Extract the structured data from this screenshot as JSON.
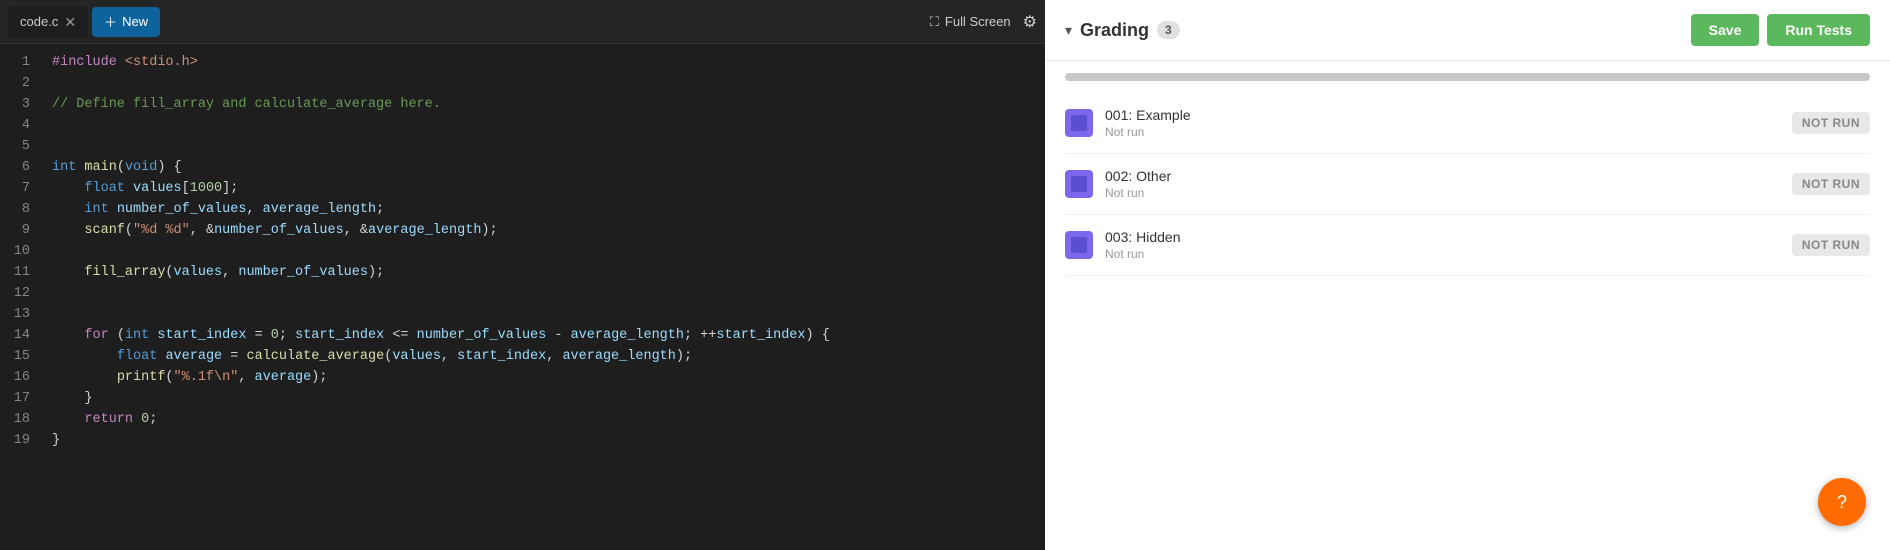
{
  "editor": {
    "tab_filename": "code.c",
    "new_tab_label": "New",
    "fullscreen_label": "Full Screen",
    "lines": [
      {
        "num": 1,
        "tokens": [
          {
            "t": "kw-include",
            "v": "#include"
          },
          {
            "t": "kw-punct",
            "v": " "
          },
          {
            "t": "kw-header",
            "v": "<stdio.h>"
          }
        ]
      },
      {
        "num": 2,
        "tokens": []
      },
      {
        "num": 3,
        "tokens": [
          {
            "t": "kw-comment",
            "v": "// Define fill_array and calculate_average here."
          }
        ]
      },
      {
        "num": 4,
        "tokens": []
      },
      {
        "num": 5,
        "tokens": []
      },
      {
        "num": 6,
        "tokens": [
          {
            "t": "kw-int",
            "v": "int"
          },
          {
            "t": "kw-punct",
            "v": " "
          },
          {
            "t": "kw-fn",
            "v": "main"
          },
          {
            "t": "kw-punct",
            "v": "("
          },
          {
            "t": "kw-void",
            "v": "void"
          },
          {
            "t": "kw-punct",
            "v": ") {"
          }
        ]
      },
      {
        "num": 7,
        "tokens": [
          {
            "t": "kw-punct",
            "v": "    "
          },
          {
            "t": "kw-float",
            "v": "float"
          },
          {
            "t": "kw-punct",
            "v": " "
          },
          {
            "t": "kw-var",
            "v": "values"
          },
          {
            "t": "kw-punct",
            "v": "["
          },
          {
            "t": "kw-num",
            "v": "1000"
          },
          {
            "t": "kw-punct",
            "v": "];"
          }
        ]
      },
      {
        "num": 8,
        "tokens": [
          {
            "t": "kw-punct",
            "v": "    "
          },
          {
            "t": "kw-int",
            "v": "int"
          },
          {
            "t": "kw-punct",
            "v": " "
          },
          {
            "t": "kw-var",
            "v": "number_of_values"
          },
          {
            "t": "kw-punct",
            "v": ", "
          },
          {
            "t": "kw-var",
            "v": "average_length"
          },
          {
            "t": "kw-punct",
            "v": ";"
          }
        ]
      },
      {
        "num": 9,
        "tokens": [
          {
            "t": "kw-punct",
            "v": "    "
          },
          {
            "t": "kw-fn",
            "v": "scanf"
          },
          {
            "t": "kw-punct",
            "v": "("
          },
          {
            "t": "kw-str",
            "v": "\"%d %d\""
          },
          {
            "t": "kw-punct",
            "v": ", &"
          },
          {
            "t": "kw-var",
            "v": "number_of_values"
          },
          {
            "t": "kw-punct",
            "v": ", &"
          },
          {
            "t": "kw-var",
            "v": "average_length"
          },
          {
            "t": "kw-punct",
            "v": ");"
          }
        ]
      },
      {
        "num": 10,
        "tokens": []
      },
      {
        "num": 11,
        "tokens": [
          {
            "t": "kw-punct",
            "v": "    "
          },
          {
            "t": "kw-fn",
            "v": "fill_array"
          },
          {
            "t": "kw-punct",
            "v": "("
          },
          {
            "t": "kw-var",
            "v": "values"
          },
          {
            "t": "kw-punct",
            "v": ", "
          },
          {
            "t": "kw-var",
            "v": "number_of_values"
          },
          {
            "t": "kw-punct",
            "v": ");"
          }
        ]
      },
      {
        "num": 12,
        "tokens": []
      },
      {
        "num": 13,
        "tokens": []
      },
      {
        "num": 14,
        "tokens": [
          {
            "t": "kw-for",
            "v": "    for"
          },
          {
            "t": "kw-punct",
            "v": " ("
          },
          {
            "t": "kw-int",
            "v": "int"
          },
          {
            "t": "kw-punct",
            "v": " "
          },
          {
            "t": "kw-var",
            "v": "start_index"
          },
          {
            "t": "kw-punct",
            "v": " = "
          },
          {
            "t": "kw-num",
            "v": "0"
          },
          {
            "t": "kw-punct",
            "v": "; "
          },
          {
            "t": "kw-var",
            "v": "start_index"
          },
          {
            "t": "kw-punct",
            "v": " <= "
          },
          {
            "t": "kw-var",
            "v": "number_of_values"
          },
          {
            "t": "kw-punct",
            "v": " - "
          },
          {
            "t": "kw-var",
            "v": "average_length"
          },
          {
            "t": "kw-punct",
            "v": "; ++"
          },
          {
            "t": "kw-var",
            "v": "start_index"
          },
          {
            "t": "kw-punct",
            "v": ") {"
          }
        ],
        "loop": true
      },
      {
        "num": 15,
        "tokens": [
          {
            "t": "kw-punct",
            "v": "        "
          },
          {
            "t": "kw-float",
            "v": "float"
          },
          {
            "t": "kw-punct",
            "v": " "
          },
          {
            "t": "kw-var",
            "v": "average"
          },
          {
            "t": "kw-punct",
            "v": " = "
          },
          {
            "t": "kw-fn",
            "v": "calculate_average"
          },
          {
            "t": "kw-punct",
            "v": "("
          },
          {
            "t": "kw-var",
            "v": "values"
          },
          {
            "t": "kw-punct",
            "v": ", "
          },
          {
            "t": "kw-var",
            "v": "start_index"
          },
          {
            "t": "kw-punct",
            "v": ", "
          },
          {
            "t": "kw-var",
            "v": "average_length"
          },
          {
            "t": "kw-punct",
            "v": ");"
          }
        ],
        "loop": true
      },
      {
        "num": 16,
        "tokens": [
          {
            "t": "kw-punct",
            "v": "        "
          },
          {
            "t": "kw-fn",
            "v": "printf"
          },
          {
            "t": "kw-punct",
            "v": "("
          },
          {
            "t": "kw-str",
            "v": "\"%.1f\\n\""
          },
          {
            "t": "kw-punct",
            "v": ", "
          },
          {
            "t": "kw-var",
            "v": "average"
          },
          {
            "t": "kw-punct",
            "v": ");"
          }
        ],
        "loop": true
      },
      {
        "num": 17,
        "tokens": [
          {
            "t": "kw-punct",
            "v": "    }"
          }
        ],
        "loop": true
      },
      {
        "num": 18,
        "tokens": [
          {
            "t": "kw-punct",
            "v": "    "
          },
          {
            "t": "kw-return",
            "v": "return"
          },
          {
            "t": "kw-punct",
            "v": " "
          },
          {
            "t": "kw-num",
            "v": "0"
          },
          {
            "t": "kw-punct",
            "v": ";"
          }
        ]
      },
      {
        "num": 19,
        "tokens": [
          {
            "t": "kw-punct",
            "v": "}"
          }
        ]
      }
    ]
  },
  "grading": {
    "title": "Grading",
    "badge": "3",
    "save_label": "Save",
    "run_tests_label": "Run Tests",
    "tests": [
      {
        "id": "001",
        "name": "001: Example",
        "status": "NOT RUN",
        "sub_status": "Not run"
      },
      {
        "id": "002",
        "name": "002: Other",
        "status": "NOT RUN",
        "sub_status": "Not run"
      },
      {
        "id": "003",
        "name": "003: Hidden",
        "status": "NOT RUN",
        "sub_status": "Not run"
      }
    ]
  },
  "chat": {
    "icon": "?"
  }
}
